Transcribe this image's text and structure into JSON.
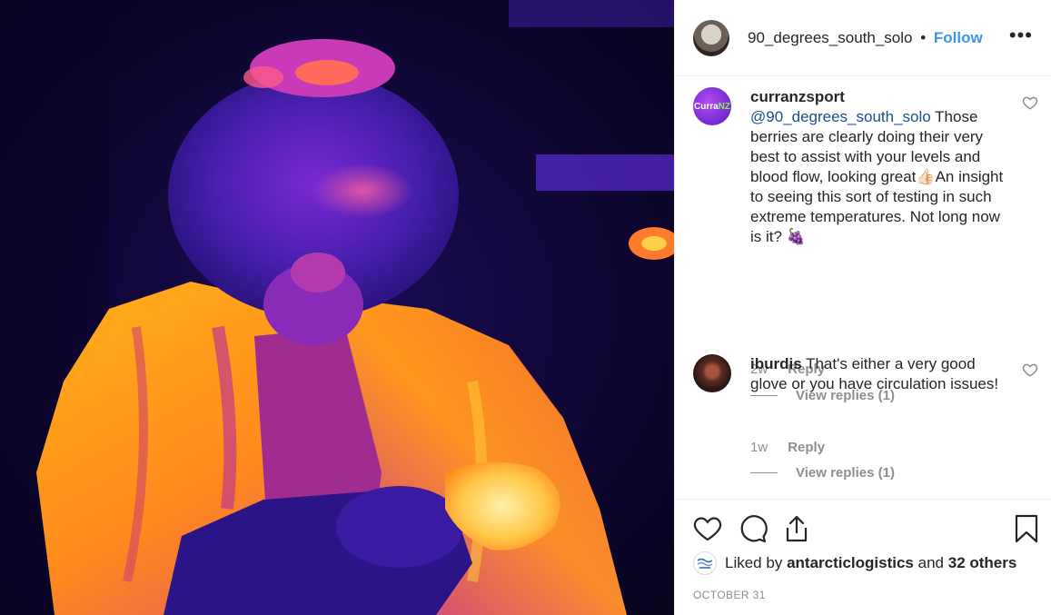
{
  "post": {
    "author": "90_degrees_south_solo",
    "separator": "•",
    "follow_label": "Follow",
    "more_label": "•••"
  },
  "comments": [
    {
      "username": "curranzsport",
      "avatar_text": "Curra",
      "avatar_text_accent": "NZ",
      "mention": "@90_degrees_south_solo",
      "text": "Those berries are clearly doing their very best to assist with your levels and blood flow, looking great👍🏻An insight to seeing this sort of testing in such extreme temperatures. Not long now is it? 🍇",
      "age": "2w",
      "reply_label": "Reply",
      "view_replies": "View replies (1)"
    },
    {
      "username": "iburdis",
      "text": "That's either a very good glove or you have circulation issues!",
      "age": "1w",
      "reply_label": "Reply",
      "view_replies": "View replies (1)"
    }
  ],
  "likes": {
    "prefix": "Liked by",
    "user": "antarcticlogistics",
    "joiner": "and",
    "others": "32 others"
  },
  "date": "OCTOBER 31",
  "colors": {
    "follow": "#3897f0",
    "mention": "#1d4f8a",
    "muted": "#8e8e8e",
    "text": "#262626"
  },
  "icons": [
    "heart-icon",
    "comment-icon",
    "share-icon",
    "bookmark-icon",
    "more-icon"
  ]
}
